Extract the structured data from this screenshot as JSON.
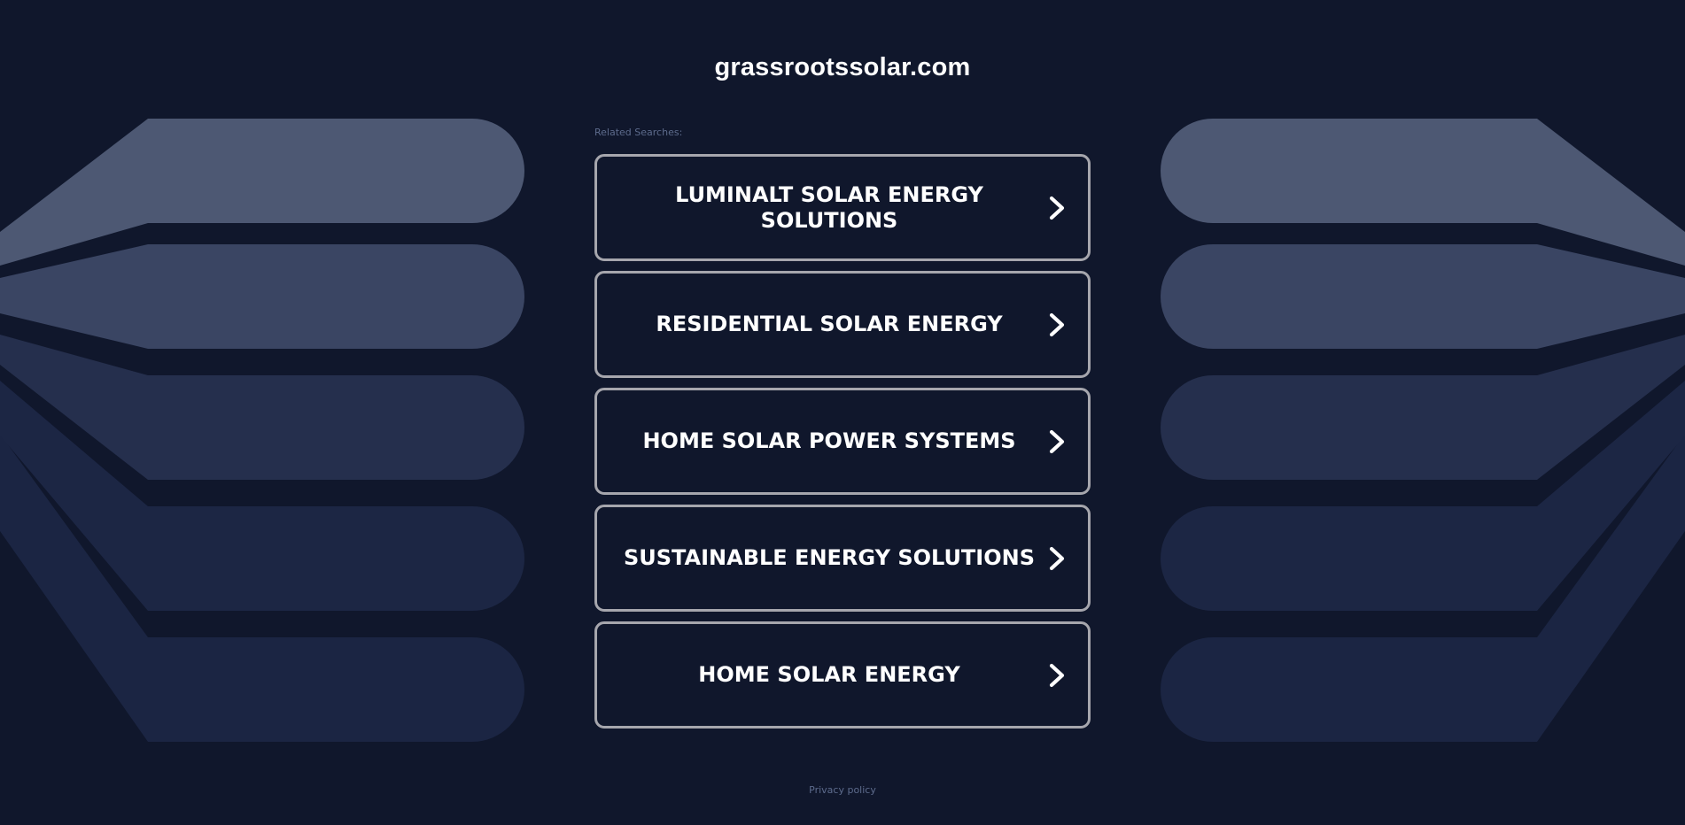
{
  "page": {
    "domain": "grassrootssolar.com",
    "related_label": "Related Searches:",
    "privacy_label": "Privacy policy"
  },
  "colors": {
    "background": "#10172c",
    "button_border": "#a6a6ad",
    "muted_text": "#5d6b8c",
    "band_1": "#4d5873",
    "band_2": "#3a4563",
    "band_3": "#252f4d",
    "band_4": "#1c2644",
    "band_5": "#1b2543"
  },
  "searches": [
    {
      "label": "LUMINALT SOLAR ENERGY SOLUTIONS"
    },
    {
      "label": "RESIDENTIAL SOLAR ENERGY"
    },
    {
      "label": "HOME SOLAR POWER SYSTEMS"
    },
    {
      "label": "SUSTAINABLE ENERGY SOLUTIONS"
    },
    {
      "label": "HOME SOLAR ENERGY"
    }
  ],
  "icons": {
    "search_item_arrow": "chevron-right-icon"
  }
}
